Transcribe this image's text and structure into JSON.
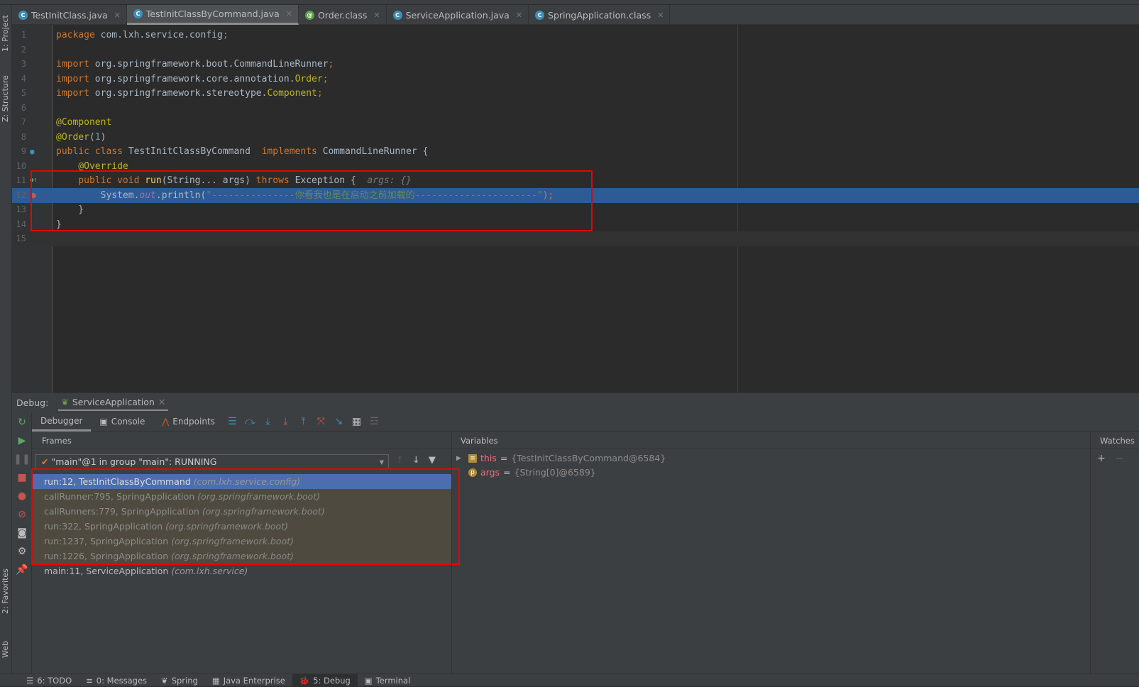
{
  "tabs": [
    {
      "label": "TestInitClass.java",
      "icon": "C",
      "color": "#3d8fb8",
      "active": false
    },
    {
      "label": "TestInitClassByCommand.java",
      "icon": "C",
      "color": "#3d8fb8",
      "active": true
    },
    {
      "label": "Order.class",
      "icon": "@",
      "color": "#5a9f46",
      "active": false
    },
    {
      "label": "ServiceApplication.java",
      "icon": "C",
      "color": "#3d8fb8",
      "active": false
    },
    {
      "label": "SpringApplication.class",
      "icon": "C",
      "color": "#3d8fb8",
      "active": false
    }
  ],
  "left_tools": [
    "1: Project",
    "Z: Structure",
    "2: Favorites",
    "Web"
  ],
  "code": [
    {
      "n": "1",
      "t": [
        [
          "package ",
          "kw"
        ],
        [
          "com.lxh.service.config",
          "tx"
        ],
        [
          ";",
          "kw"
        ]
      ]
    },
    {
      "n": "2",
      "t": []
    },
    {
      "n": "3",
      "t": [
        [
          "import ",
          "kw"
        ],
        [
          "org.springframework.boot.CommandLineRunner",
          "tx"
        ],
        [
          ";",
          "kw"
        ]
      ]
    },
    {
      "n": "4",
      "t": [
        [
          "import ",
          "kw"
        ],
        [
          "org.springframework.core.annotation.",
          "tx"
        ],
        [
          "Order",
          "ann"
        ],
        [
          ";",
          "kw"
        ]
      ]
    },
    {
      "n": "5",
      "t": [
        [
          "import ",
          "kw"
        ],
        [
          "org.springframework.stereotype.",
          "tx"
        ],
        [
          "Component",
          "ann"
        ],
        [
          ";",
          "kw"
        ]
      ]
    },
    {
      "n": "6",
      "t": []
    },
    {
      "n": "7",
      "t": [
        [
          "@Component",
          "ann"
        ]
      ]
    },
    {
      "n": "8",
      "t": [
        [
          "@Order",
          "ann"
        ],
        [
          "(",
          "tx"
        ],
        [
          "1",
          "num"
        ],
        [
          ")",
          "tx"
        ]
      ]
    },
    {
      "n": "9",
      "t": [
        [
          "public class ",
          "kw"
        ],
        [
          "TestInitClassByCommand  ",
          "tx"
        ],
        [
          "implements ",
          "kw"
        ],
        [
          "CommandLineRunner {",
          "tx"
        ]
      ]
    },
    {
      "n": "10",
      "t": [
        [
          "    @Override",
          "ann"
        ]
      ]
    },
    {
      "n": "11",
      "t": [
        [
          "    public void ",
          "kw"
        ],
        [
          "run",
          "mth"
        ],
        [
          "(String... args) ",
          "tx"
        ],
        [
          "throws ",
          "kw"
        ],
        [
          "Exception",
          "tx"
        ],
        [
          " {  ",
          "tx"
        ],
        [
          "args: {}",
          "hint"
        ]
      ]
    },
    {
      "n": "12",
      "t": [
        [
          "        System.",
          "tx"
        ],
        [
          "out",
          "fld"
        ],
        [
          ".println(",
          "tx"
        ],
        [
          "\"---------------你看我也是在启动之前加载的----------------------\"",
          "str"
        ],
        [
          ");",
          "kw"
        ]
      ],
      "highlight": true
    },
    {
      "n": "13",
      "t": [
        [
          "    }",
          "tx"
        ]
      ]
    },
    {
      "n": "14",
      "t": [
        [
          "}",
          "tx"
        ]
      ]
    },
    {
      "n": "15",
      "t": [],
      "current": true
    }
  ],
  "debug": {
    "label": "Debug:",
    "session": "ServiceApplication",
    "tabs": [
      "Debugger",
      "Console",
      "Endpoints"
    ],
    "frames_title": "Frames",
    "thread": "\"main\"@1 in group \"main\": RUNNING",
    "frames": [
      {
        "method": "run:12, TestInitClassByCommand",
        "pkg": "(com.lxh.service.config)",
        "state": "sel"
      },
      {
        "method": "callRunner:795, SpringApplication",
        "pkg": "(org.springframework.boot)",
        "state": "lib"
      },
      {
        "method": "callRunners:779, SpringApplication",
        "pkg": "(org.springframework.boot)",
        "state": "lib"
      },
      {
        "method": "run:322, SpringApplication",
        "pkg": "(org.springframework.boot)",
        "state": "lib"
      },
      {
        "method": "run:1237, SpringApplication",
        "pkg": "(org.springframework.boot)",
        "state": "lib"
      },
      {
        "method": "run:1226, SpringApplication",
        "pkg": "(org.springframework.boot)",
        "state": "lib"
      },
      {
        "method": "main:11, ServiceApplication",
        "pkg": "(com.lxh.service)",
        "state": ""
      }
    ],
    "variables_title": "Variables",
    "variables": [
      {
        "name": "this",
        "value": "{TestInitClassByCommand@6584}"
      },
      {
        "name": "args",
        "value": "{String[0]@6589}"
      }
    ],
    "watches_title": "Watches"
  },
  "bottom": [
    "6: TODO",
    "0: Messages",
    "Spring",
    "Java Enterprise",
    "5: Debug",
    "Terminal"
  ],
  "colors": {
    "highlight_line": "#2d5b95",
    "selected_frame": "#4b6eaf",
    "library_frame": "#4e4a3f",
    "annotation_box": "#ee0000"
  }
}
